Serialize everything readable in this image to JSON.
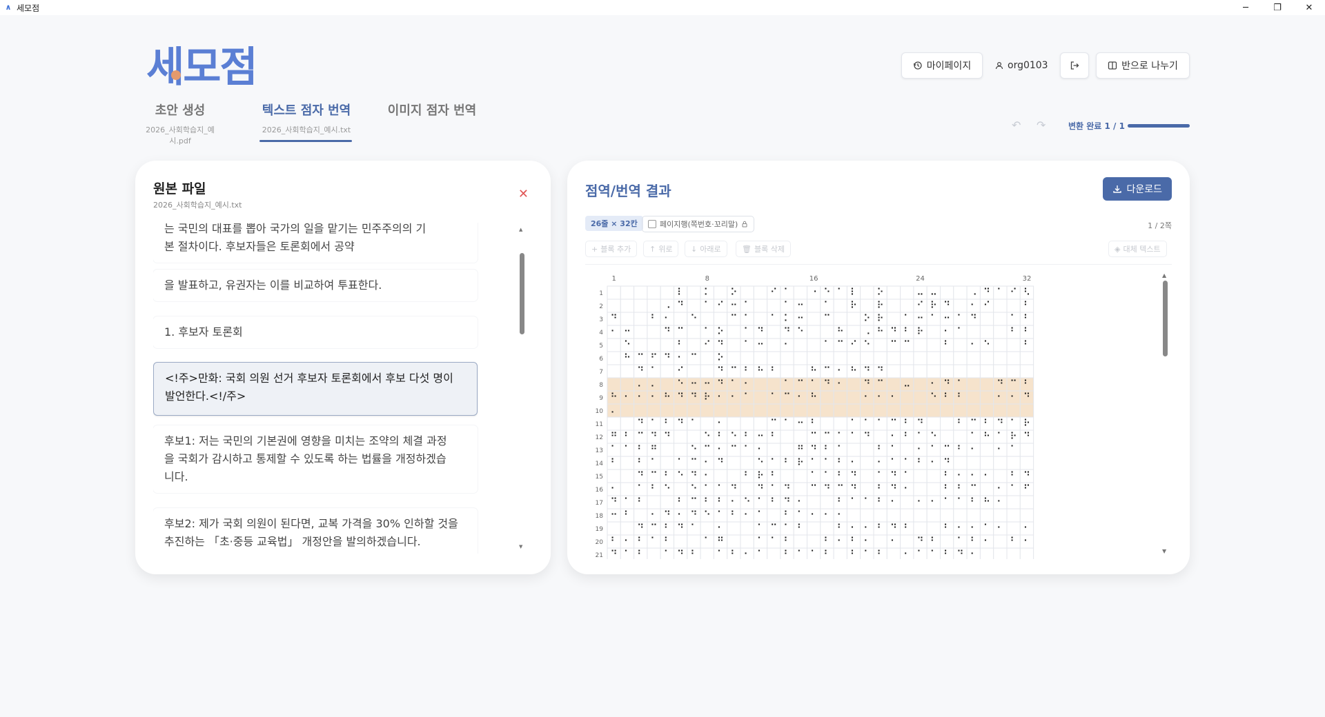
{
  "window": {
    "title": "세모점",
    "controls": [
      "─",
      "❐",
      "✕"
    ]
  },
  "logo": {
    "text": "세모점"
  },
  "header": {
    "mypage_label": "마이페이지",
    "user_name": "org0103",
    "split_label": "반으로 나누기"
  },
  "tabs": [
    {
      "label": "초안 생성",
      "file": "2026_사회학습지_예시.pdf"
    },
    {
      "label": "텍스트 점자 번역",
      "file": "2026_사회학습지_예시.txt"
    },
    {
      "label": "이미지 점자 번역",
      "file": ""
    }
  ],
  "progress": {
    "label": "변환 완료 1 / 1",
    "fraction": 1.0
  },
  "left_panel": {
    "title": "원본 파일",
    "filename": "2026_사회학습지_예시.txt",
    "paragraphs": [
      {
        "lines": [
          "는 국민의 대표를 뽑아 국가의 일을 맡기는 민주주의의 기",
          "본 절차이다. 후보자들은 토론회에서 공약"
        ]
      },
      {
        "lines": [
          "을 발표하고, 유권자는 이를 비교하여 투표한다."
        ]
      },
      {
        "lines": [
          "1. 후보자 토론회"
        ]
      },
      {
        "lines": [
          "<!주>만화: 국회 의원 선거 후보자 토론회에서 후보 다섯 명이",
          "발언한다.<!/주>"
        ]
      },
      {
        "lines": [
          "후보1: 저는 국민의 기본권에 영향을 미치는 조약의 체결 과정",
          "을 국회가 감시하고 통제할 수 있도록 하는 법률을 개정하겠습",
          "니다."
        ]
      },
      {
        "lines": [
          "후보2: 제가 국회 의원이 된다면, 교복 가격을 30% 인하할 것을",
          "추진하는 「초·중등 교육법」 개정안을 발의하겠습니다."
        ]
      }
    ]
  },
  "right_panel": {
    "title": "점역/번역 결과",
    "download_label": "다운로드",
    "size_chip": "26줄 × 32칸",
    "page_num_checkbox": "페이지행(쪽번호·꼬리말)",
    "page_indicator": "1 / 2쪽",
    "toolbar": {
      "add_label": "블록 추가",
      "up_label": "위로",
      "down_label": "아래로",
      "delete_label": "블록 삭제",
      "replace_label": "대체 텍스트"
    },
    "grid": {
      "rows": 26,
      "cols": 32,
      "col_labels": [
        "1",
        "8",
        "16",
        "24",
        "32"
      ],
      "highlight_rows": [
        8,
        9,
        10
      ],
      "cells": [
        "⠀⠀⠀⠀⠀⠇⠀⠅⠀⠕⠀⠀⠊⠁⠀⠐⠑⠁⠇⠀⠕⠀⠀⠤⠤⠀⠀⠠⠙⠁⠊⠣⠀⠀⠓⠗⠀⠇⠀⠁⠺⠀⠙",
        "⠀⠀⠀⠀⠠⠙⠀⠁⠊⠒⠁⠀⠀⠁⠒⠀⠁⠀⠗⠀⠗⠀⠀⠊⠗⠙⠀⠂⠊⠀⠀⠃⠓⠀⠃⠀⠗⠀⠒⠀⠠",
        "⠙⠀⠀⠃⠂⠀⠑⠀⠀⠉⠁⠀⠁⠅⠒⠀⠉⠀⠀⠕⠗⠀⠁⠒⠁⠒⠁⠙⠀⠀⠁⠃⠀⠕⠓⠀⠀⠃⠙⠂⠂⠃",
        "⠂⠒⠀⠀⠙⠉⠀⠁⠕⠀⠁⠙⠀⠙⠑⠀⠀⠓⠀⠠⠓⠙⠃⠗⠀⠂⠁⠀⠀⠀⠃⠃⠁⠀⠀⠀⠀⠀⠀⠀",
        "⠀⠑⠀⠀⠀⠃⠀⠊⠙⠀⠁⠒⠀⠂⠀⠀⠁⠉⠊⠑⠀⠉⠉⠀⠀⠃⠀⠂⠑⠀⠀⠃⠀⠁⠙⠃⠑⠀⠀⠀⠀",
        "⠀⠓⠉⠋⠙⠂⠉⠀⠕⠀⠀⠀⠀⠀⠀⠀⠀⠀⠀⠀⠀⠀⠀⠀⠀⠀⠀⠀⠀⠀⠀⠀⠀⠀⠀⠀⠀⠀⠀⠀",
        "⠀⠀⠙⠁⠀⠊⠀⠀⠙⠉⠃⠓⠃⠀⠀⠓⠉⠂⠓⠙⠙⠀⠀⠀⠀⠀⠀⠀⠀⠀⠀⠀⠀⠀⠀⠀⠀⠀⠀⠀",
        "⠀⠀⠄⠄⠀⠑⠒⠒⠙⠁⠂⠀⠀⠁⠉⠁⠙⠂⠀⠙⠉⠀⠤⠀⠂⠙⠁⠀⠀⠙⠉⠃⠃⠂⠀⠀⠀⠀⠀⠀",
        "⠓⠂⠂⠂⠓⠙⠙⠗⠂⠂⠁⠀⠁⠉⠂⠓⠀⠀⠀⠂⠂⠂⠀⠀⠑⠃⠃⠀⠀⠂⠂⠙⠁⠒⠂⠂⠀⠀⠀⠀",
        "⠄⠀⠀⠀⠀⠀⠀⠀⠀⠀⠀⠀⠀⠀⠀⠀⠀⠀⠀⠀⠀⠀⠀⠀⠀⠀⠀⠀⠀⠀⠀⠀⠀⠀⠀⠀⠀⠀⠀⠀",
        "⠀⠀⠙⠁⠃⠙⠁⠀⠂⠀⠀⠀⠉⠁⠒⠃⠀⠀⠁⠁⠁⠉⠃⠙⠀⠀⠃⠉⠃⠙⠁⠗⠒⠃⠀⠀⠀⠀⠀⠀",
        "⠛⠃⠉⠙⠙⠀⠀⠑⠃⠑⠃⠒⠃⠀⠀⠉⠉⠁⠁⠙⠀⠂⠃⠁⠑⠀⠀⠁⠓⠁⠗⠙⠀⠀⠁⠁⠀⠀⠀⠀",
        "⠁⠁⠃⠛⠀⠀⠑⠉⠂⠉⠁⠂⠀⠀⠛⠙⠃⠁⠀⠀⠃⠁⠀⠂⠁⠉⠃⠂⠀⠂⠁⠀⠁⠁⠀⠀⠀⠀⠀⠀",
        "⠃⠀⠃⠁⠀⠁⠉⠂⠙⠀⠀⠑⠁⠃⠗⠁⠁⠃⠂⠀⠂⠁⠁⠃⠂⠙⠀⠀⠀⠀⠀⠀⠀⠀⠀⠀⠀⠀⠀⠀",
        "⠀⠀⠙⠉⠃⠑⠙⠂⠀⠀⠃⠗⠃⠀⠀⠁⠁⠃⠙⠀⠁⠙⠁⠀⠀⠃⠂⠂⠂⠀⠃⠙⠀⠀⠀⠀⠀⠀⠀⠀",
        "⠂⠀⠁⠃⠑⠀⠑⠁⠁⠙⠀⠙⠁⠙⠀⠉⠙⠉⠙⠀⠃⠙⠂⠀⠀⠃⠃⠉⠀⠂⠁⠋⠀⠀⠀⠀⠀⠀⠀⠀",
        "⠙⠁⠃⠀⠀⠃⠉⠃⠃⠂⠑⠁⠃⠙⠂⠀⠀⠃⠁⠁⠃⠂⠀⠂⠂⠁⠁⠃⠓⠂⠀⠀⠀⠀⠀⠀⠀⠀⠀⠀",
        "⠒⠃⠀⠂⠙⠂⠙⠑⠁⠃⠂⠁⠀⠃⠁⠂⠂⠂⠀⠀⠀⠀⠀⠀⠀⠀⠀⠀⠀⠀⠀⠀⠀⠀⠀⠀⠀⠀⠀⠀",
        "⠀⠀⠙⠉⠃⠙⠁⠀⠂⠀⠀⠁⠉⠁⠃⠀⠀⠃⠂⠂⠃⠙⠃⠀⠀⠃⠂⠂⠁⠂⠀⠂⠀⠀⠀⠀⠀⠀⠀⠀",
        "⠃⠂⠃⠁⠃⠀⠀⠁⠛⠀⠀⠁⠁⠃⠀⠀⠃⠂⠃⠂⠀⠂⠀⠙⠃⠀⠁⠃⠂⠀⠃⠂⠀⠀⠀⠀⠀⠀⠀⠀",
        "⠙⠁⠃⠀⠁⠙⠃⠀⠁⠃⠂⠁⠀⠃⠁⠁⠃⠀⠃⠁⠃⠀⠂⠁⠁⠃⠙⠂⠀⠀⠀⠀⠀⠀⠀⠀⠀⠀⠀⠀"
      ]
    }
  }
}
